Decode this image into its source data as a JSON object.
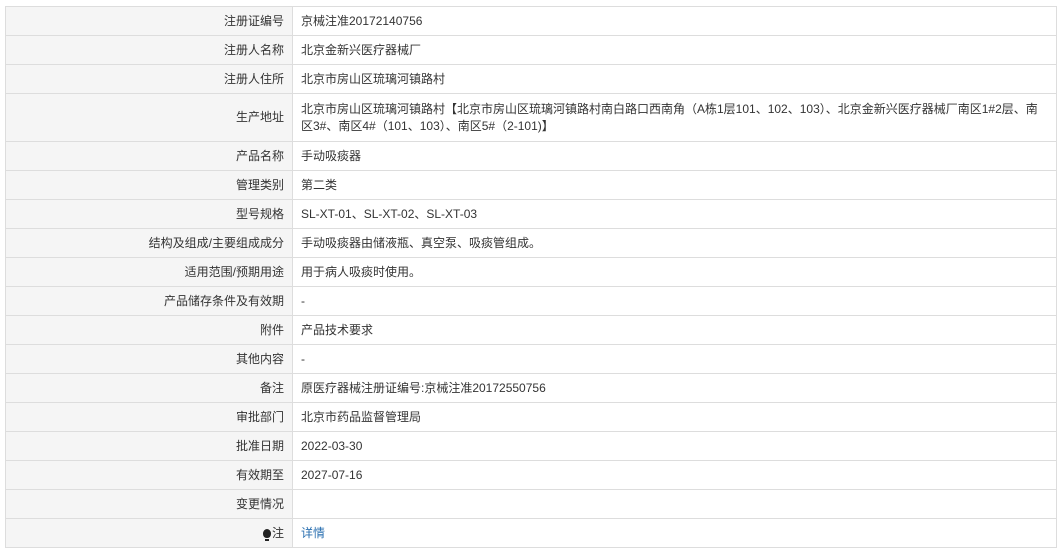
{
  "rows": [
    {
      "label": "注册证编号",
      "value": "京械注准20172140756"
    },
    {
      "label": "注册人名称",
      "value": "北京金新兴医疗器械厂"
    },
    {
      "label": "注册人住所",
      "value": "北京市房山区琉璃河镇路村"
    },
    {
      "label": "生产地址",
      "value": "北京市房山区琉璃河镇路村【北京市房山区琉璃河镇路村南白路口西南角（A栋1层101、102、103）、北京金新兴医疗器械厂南区1#2层、南区3#、南区4#（101、103）、南区5#（2-101)】"
    },
    {
      "label": "产品名称",
      "value": "手动吸痰器"
    },
    {
      "label": "管理类别",
      "value": "第二类"
    },
    {
      "label": "型号规格",
      "value": "SL-XT-01、SL-XT-02、SL-XT-03"
    },
    {
      "label": "结构及组成/主要组成成分",
      "value": "手动吸痰器由储液瓶、真空泵、吸痰管组成。"
    },
    {
      "label": "适用范围/预期用途",
      "value": "用于病人吸痰时使用。"
    },
    {
      "label": "产品储存条件及有效期",
      "value": "-"
    },
    {
      "label": "附件",
      "value": "产品技术要求"
    },
    {
      "label": "其他内容",
      "value": "-"
    },
    {
      "label": "备注",
      "value": "原医疗器械注册证编号:京械注准20172550756"
    },
    {
      "label": "审批部门",
      "value": "北京市药品监督管理局"
    },
    {
      "label": "批准日期",
      "value": "2022-03-30"
    },
    {
      "label": "有效期至",
      "value": "2027-07-16"
    },
    {
      "label": "变更情况",
      "value": ""
    }
  ],
  "note": {
    "label": "注",
    "link": "详情",
    "icon": "lightbulb-icon"
  }
}
